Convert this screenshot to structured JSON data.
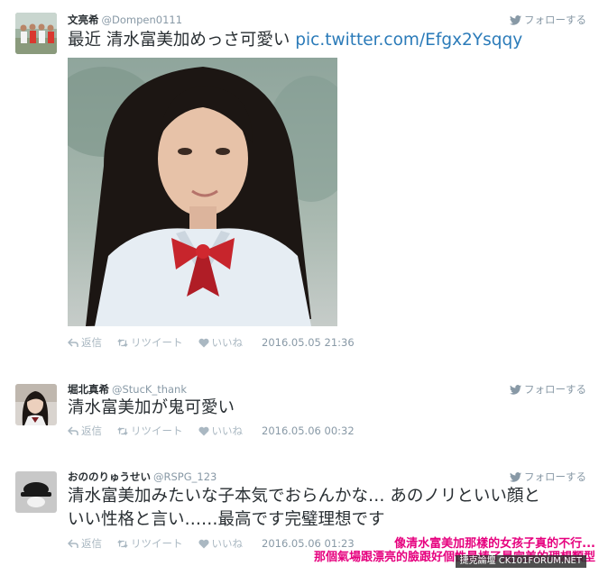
{
  "follow_label": "フォローする",
  "actions": {
    "reply": "返信",
    "retweet": "リツイート",
    "like": "いいね"
  },
  "tweets": [
    {
      "name": "文亮希",
      "handle": "@Dompen0111",
      "text": "最近 清水富美加めっさ可愛い ",
      "link": "pic.twitter.com/Efgx2Ysqqy",
      "date": "2016.05.05 21:36"
    },
    {
      "name": "堀北真希",
      "handle": "@StucK_thank",
      "text": "清水富美加が鬼可愛い",
      "date": "2016.05.06 00:32"
    },
    {
      "name": "おののりゅうせい",
      "handle": "@RSPG_123",
      "text_line1": "清水富美加みたいな子本気でおらんかな… あのノリといい顔と",
      "text_line2": "いい性格と言い……最高です完璧理想です",
      "date": "2016.05.06 01:23"
    }
  ],
  "overlay": {
    "caption_line1": "像清水富美加那樣的女孩子真的不行...",
    "caption_line2": "那個氣場跟漂亮的臉跟好個性最棒了是完美的理想類型",
    "watermark": "捷克論壇 CK101FORUM.NET"
  },
  "colors": {
    "link": "#2b7bb9",
    "muted": "#8899a6",
    "caption": "#e6007e"
  }
}
